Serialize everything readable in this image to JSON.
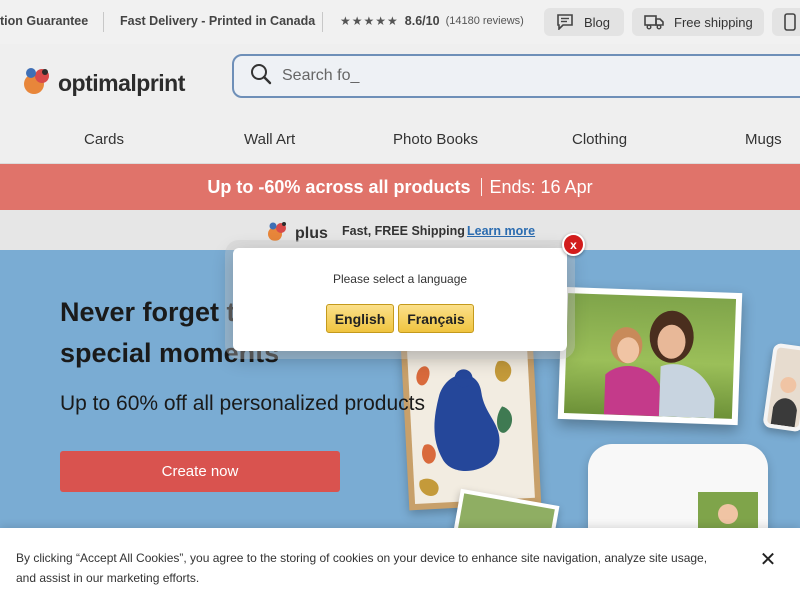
{
  "topbar": {
    "guarantee": "tion Guarantee",
    "delivery": "Fast Delivery - Printed in Canada",
    "rating": {
      "stars_icon": "star-rating-icon",
      "stars_value": 4.3,
      "score": "8.6/10",
      "reviews": "(14180 reviews)"
    },
    "blog_label": "Blog",
    "shipping_label": "Free shipping"
  },
  "header": {
    "logo_text": "optimalprint",
    "search": {
      "placeholder": "Search fo_"
    }
  },
  "nav": {
    "items": [
      "Cards",
      "Wall Art",
      "Photo Books",
      "Clothing",
      "Mugs"
    ]
  },
  "promo": {
    "main": "Up to -60% across all products",
    "ends": "Ends: 16 Apr"
  },
  "plus": {
    "logo_text": "plus",
    "text": "Fast, FREE Shipping",
    "link": "Learn more"
  },
  "hero": {
    "title_line1": "Never forget t",
    "title_line2": "special moments",
    "subtitle": "Up to 60% off all personalized products",
    "cta": "Create now"
  },
  "language_modal": {
    "prompt": "Please select a language",
    "options": [
      "English",
      "Français"
    ],
    "close": "x"
  },
  "cookie": {
    "text": "By clicking “Accept All Cookies”, you agree to the storing of cookies on your device to enhance site navigation, analyze site usage, and assist in our marketing efforts.",
    "close": "✕"
  },
  "colors": {
    "promo_bg": "#e0736a",
    "cta_bg": "#d9534f",
    "hero_bg": "#7aacd3",
    "search_border": "#6e8fb8",
    "link": "#2b6cb0",
    "lang_button": "#f0c43f",
    "modal_close": "#d21c1c"
  }
}
